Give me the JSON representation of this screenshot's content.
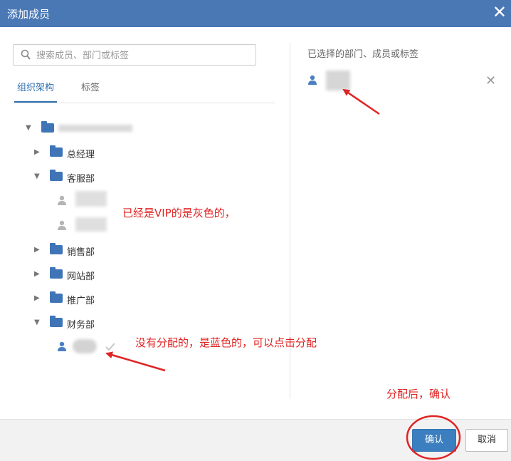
{
  "dialog": {
    "title": "添加成员",
    "close_icon": "close-icon"
  },
  "search": {
    "placeholder": "搜索成员、部门或标签"
  },
  "tabs": [
    {
      "label": "组织架构",
      "active": true
    },
    {
      "label": "标签",
      "active": false
    }
  ],
  "tree": {
    "departments": [
      {
        "label": "总经理",
        "expanded": false
      },
      {
        "label": "客服部",
        "expanded": true
      },
      {
        "label": "销售部",
        "expanded": false
      },
      {
        "label": "网站部",
        "expanded": false
      },
      {
        "label": "推广部",
        "expanded": false
      },
      {
        "label": "财务部",
        "expanded": true
      }
    ]
  },
  "right_panel": {
    "title": "已选择的部门、成员或标签"
  },
  "annotations": {
    "vip": "已经是VIP的是灰色的，",
    "unassigned": "没有分配的，是蓝色的，可以点击分配",
    "confirm_note": "分配后，确认"
  },
  "footer": {
    "confirm_label": "确认",
    "cancel_label": "取消"
  },
  "colors": {
    "titlebar": "#4a78b5",
    "accent": "#2f6fb0",
    "annotation": "#e02323"
  }
}
